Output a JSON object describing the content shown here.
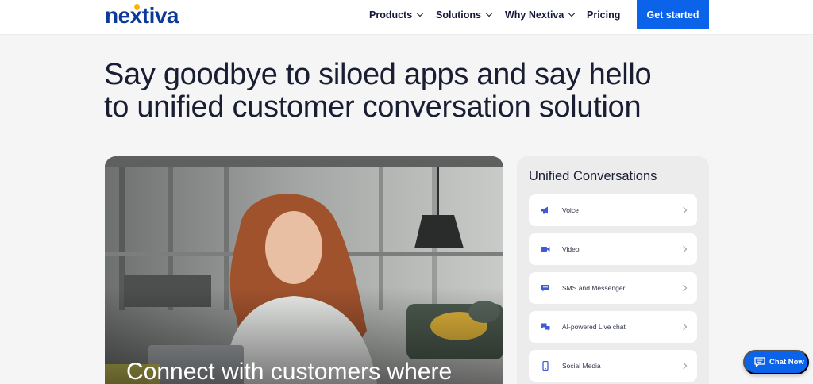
{
  "brand": {
    "name": "nextiva",
    "primary_color": "#0b3a9a",
    "accent_color": "#ffb300"
  },
  "nav": {
    "items": [
      {
        "label": "Products",
        "has_dropdown": true
      },
      {
        "label": "Solutions",
        "has_dropdown": true
      },
      {
        "label": "Why Nextiva",
        "has_dropdown": true
      },
      {
        "label": "Pricing",
        "has_dropdown": false
      }
    ],
    "cta_label": "Get started",
    "cta_color": "#0a63e8"
  },
  "hero": {
    "headline_line1": "Say goodbye to siloed apps and say hello",
    "headline_line2": "to unified customer conversation solution",
    "image_caption": "Connect with customers where"
  },
  "panel": {
    "title": "Unified Conversations",
    "items": [
      {
        "label": "Voice",
        "icon": "megaphone-icon"
      },
      {
        "label": "Video",
        "icon": "video-camera-icon"
      },
      {
        "label": "SMS and Messenger",
        "icon": "message-bubble-icon"
      },
      {
        "label": "AI-powered Live chat",
        "icon": "chat-bubbles-icon"
      },
      {
        "label": "Social Media",
        "icon": "mobile-phone-icon"
      }
    ]
  },
  "chat_widget": {
    "label": "Chat Now",
    "icon": "chat-icon"
  }
}
